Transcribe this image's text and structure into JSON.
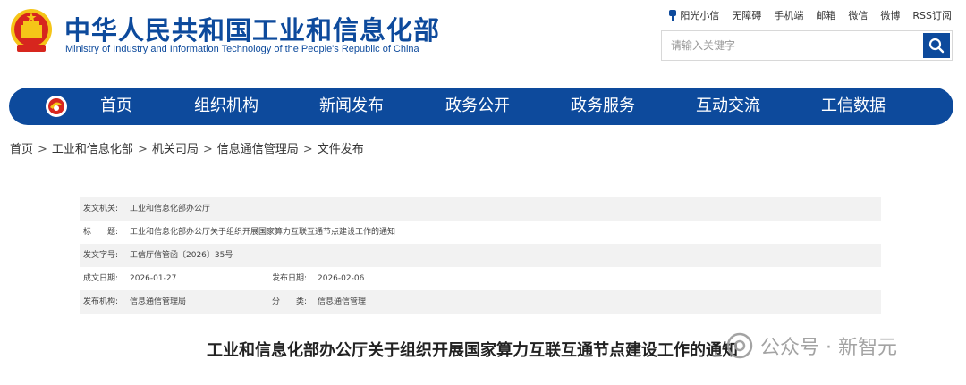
{
  "header": {
    "title": "中华人民共和国工业和信息化部",
    "subtitle": "Ministry of Industry and Information Technology of the People's Republic of China",
    "top_links": [
      "阳光小信",
      "无障碍",
      "手机端",
      "邮箱",
      "微信",
      "微博",
      "RSS订阅"
    ],
    "search": {
      "placeholder": "请输入关键字"
    }
  },
  "nav": {
    "items": [
      "首页",
      "组织机构",
      "新闻发布",
      "政务公开",
      "政务服务",
      "互动交流",
      "工信数据"
    ]
  },
  "breadcrumb": [
    "首页",
    "工业和信息化部",
    "机关司局",
    "信息通信管理局",
    "文件发布"
  ],
  "breadcrumb_sep": ">",
  "doc_info": {
    "issuer_label": "发文机关:",
    "issuer": "工业和信息化部办公厅",
    "title_label": "标　　题:",
    "title": "工业和信息化部办公厅关于组织开展国家算力互联互通节点建设工作的通知",
    "doc_no_label": "发文字号:",
    "doc_no": "工信厅信管函〔2026〕35号",
    "written_date_label": "成文日期:",
    "written_date": "2026-01-27",
    "publish_date_label": "发布日期:",
    "publish_date": "2026-02-06",
    "agency_label": "发布机构:",
    "agency": "信息通信管理局",
    "category_label": "分　　类:",
    "category": "信息通信管理"
  },
  "article_title": "工业和信息化部办公厅关于组织开展国家算力互联互通节点建设工作的通知",
  "watermark": "公众号 · 新智元",
  "colors": {
    "brand_blue": "#0d4a9c",
    "emblem_red": "#d7261e",
    "emblem_gold": "#f5c518"
  }
}
